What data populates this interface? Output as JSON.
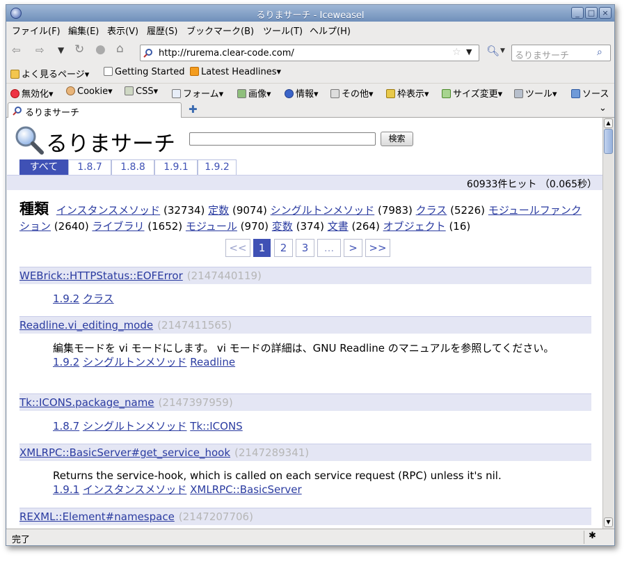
{
  "window": {
    "title": "るりまサーチ - Iceweasel"
  },
  "menu": [
    "ファイル(F)",
    "編集(E)",
    "表示(V)",
    "履歴(S)",
    "ブックマーク(B)",
    "ツール(T)",
    "ヘルプ(H)"
  ],
  "nav": {
    "url": "http://rurema.clear-code.com/",
    "search_placeholder": "るりまサーチ"
  },
  "bookmarks": [
    "よく見るページ",
    "Getting Started",
    "Latest Headlines"
  ],
  "devbar": [
    "無効化",
    "Cookie",
    "CSS",
    "フォーム",
    "画像",
    "情報",
    "その他",
    "枠表示",
    "サイズ変更",
    "ツール",
    "ソース"
  ],
  "tab": {
    "label": "るりまサーチ"
  },
  "page": {
    "site_title": "るりまサーチ",
    "search_button": "検索",
    "version_tabs": [
      "すべて",
      "1.8.7",
      "1.8.8",
      "1.9.1",
      "1.9.2"
    ],
    "hit_summary": "60933件ヒット （0.065秒）",
    "facet_heading": "種類",
    "facets": [
      {
        "label": "インスタンスメソッド",
        "count": "(32734)"
      },
      {
        "label": "定数",
        "count": "(9074)"
      },
      {
        "label": "シングルトンメソッド",
        "count": "(7983)"
      },
      {
        "label": "クラス",
        "count": "(5226)"
      },
      {
        "label": "モジュールファンクション",
        "count": "(2640)"
      },
      {
        "label": "ライブラリ",
        "count": "(1652)"
      },
      {
        "label": "モジュール",
        "count": "(970)"
      },
      {
        "label": "変数",
        "count": "(374)"
      },
      {
        "label": "文書",
        "count": "(264)"
      },
      {
        "label": "オブジェクト",
        "count": "(16)"
      }
    ],
    "pager": [
      "<<",
      "1",
      "2",
      "3",
      "...",
      ">",
      ">>"
    ],
    "entries": [
      {
        "name": "WEBrick::HTTPStatus::EOFError",
        "score": "(2147440119)",
        "desc": "",
        "version": "1.9.2",
        "kind": "クラス",
        "owner": ""
      },
      {
        "name": "Readline.vi_editing_mode",
        "score": "(2147411565)",
        "desc": "編集モードを vi モードにします。 vi モードの詳細は、GNU Readline のマニュアルを参照してください。",
        "version": "1.9.2",
        "kind": "シングルトンメソッド",
        "owner": "Readline"
      },
      {
        "name": "Tk::ICONS.package_name",
        "score": "(2147397959)",
        "desc": "",
        "version": "1.8.7",
        "kind": "シングルトンメソッド",
        "owner": "Tk::ICONS"
      },
      {
        "name": "XMLRPC::BasicServer#get_service_hook",
        "score": "(2147289341)",
        "desc": "Returns the service-hook, which is called on each service request (RPC) unless it's nil.",
        "version": "1.9.1",
        "kind": "インスタンスメソッド",
        "owner": "XMLRPC::BasicServer"
      },
      {
        "name": "REXML::Element#namespace",
        "score": "(2147207706)",
        "desc": "",
        "version": "",
        "kind": "",
        "owner": ""
      }
    ]
  },
  "status": "完了"
}
